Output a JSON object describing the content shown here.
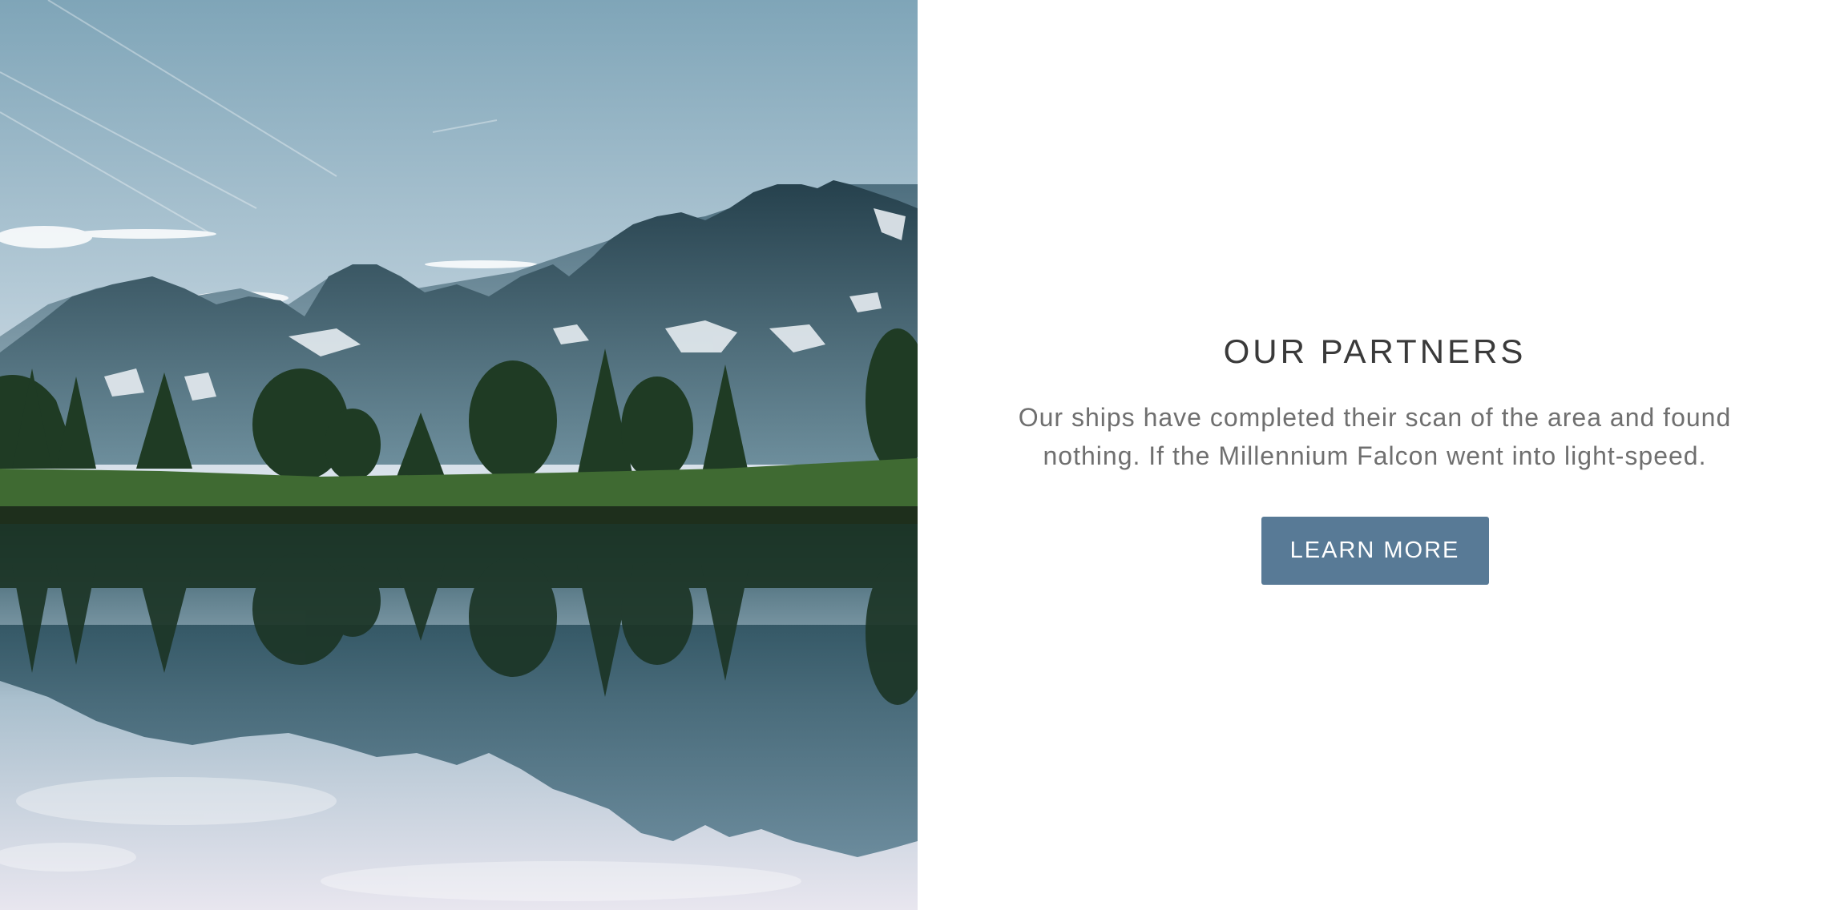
{
  "hero_image": {
    "alt": "Mountain lake landscape",
    "colors": {
      "sky_top": "#7fa5b8",
      "sky_bottom": "#dfe6ef",
      "mountain": "#2f4d5c",
      "mountain_light": "#5c7f90",
      "snow": "#e6ecf1",
      "trees": "#1f3b24",
      "grass": "#3f6a32",
      "water": "#c7d3e0",
      "reflection": "#2d4e5c"
    }
  },
  "partners": {
    "title": "OUR PARTNERS",
    "description": "Our ships have completed their scan of the area and found nothing. If the Millennium Falcon went into light-speed.",
    "button_label": "LEARN MORE",
    "button_color": "#587a96"
  }
}
